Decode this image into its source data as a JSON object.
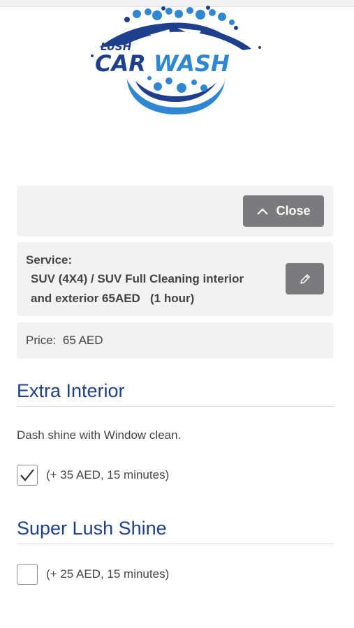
{
  "logo": {
    "line1": "LUSH",
    "line2a": "CAR",
    "line2b": "WASH"
  },
  "colors": {
    "navy": "#1d3f8c",
    "blue": "#2f86d3",
    "button_gray": "#7b7b7d",
    "panel": "#f2f2f3"
  },
  "booking": {
    "close_label": "Close",
    "close_icon": "chevron-up-icon",
    "service_label": "Service:",
    "service_line1": "SUV (4X4) / SUV Full Cleaning interior",
    "service_line2": "and exterior 65AED   (1 hour)",
    "edit_icon": "pencil-icon",
    "price_text": "Price:  65 AED"
  },
  "extras": [
    {
      "title": "Extra Interior",
      "description": "Dash shine with Window clean.",
      "option_label": "(+ 35 AED, 15 minutes)",
      "checked": true
    },
    {
      "title": "Super Lush Shine",
      "option_label": "(+ 25 AED, 15 minutes)",
      "checked": false
    }
  ]
}
